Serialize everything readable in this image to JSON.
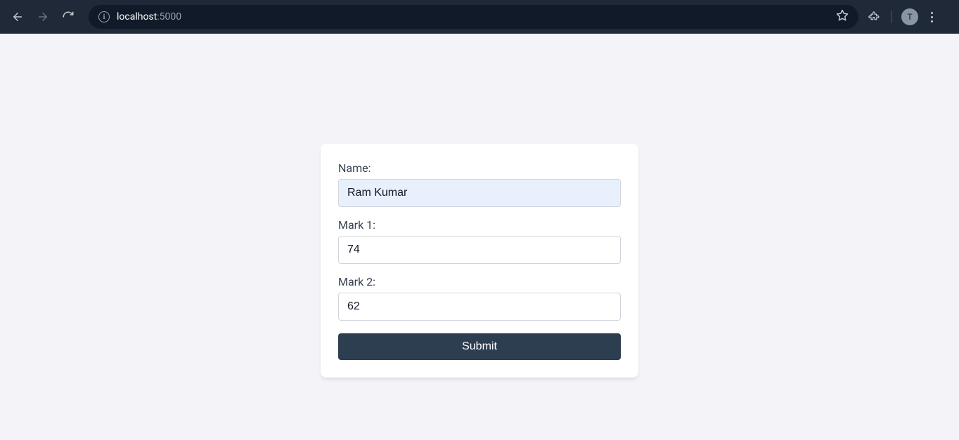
{
  "browser": {
    "url_host": "localhost",
    "url_port": ":5000",
    "avatar_initial": "T"
  },
  "form": {
    "fields": [
      {
        "label": "Name:",
        "value": "Ram Kumar",
        "autofill": true
      },
      {
        "label": "Mark 1:",
        "value": "74",
        "autofill": false
      },
      {
        "label": "Mark 2:",
        "value": "62",
        "autofill": false
      }
    ],
    "submit_label": "Submit"
  }
}
